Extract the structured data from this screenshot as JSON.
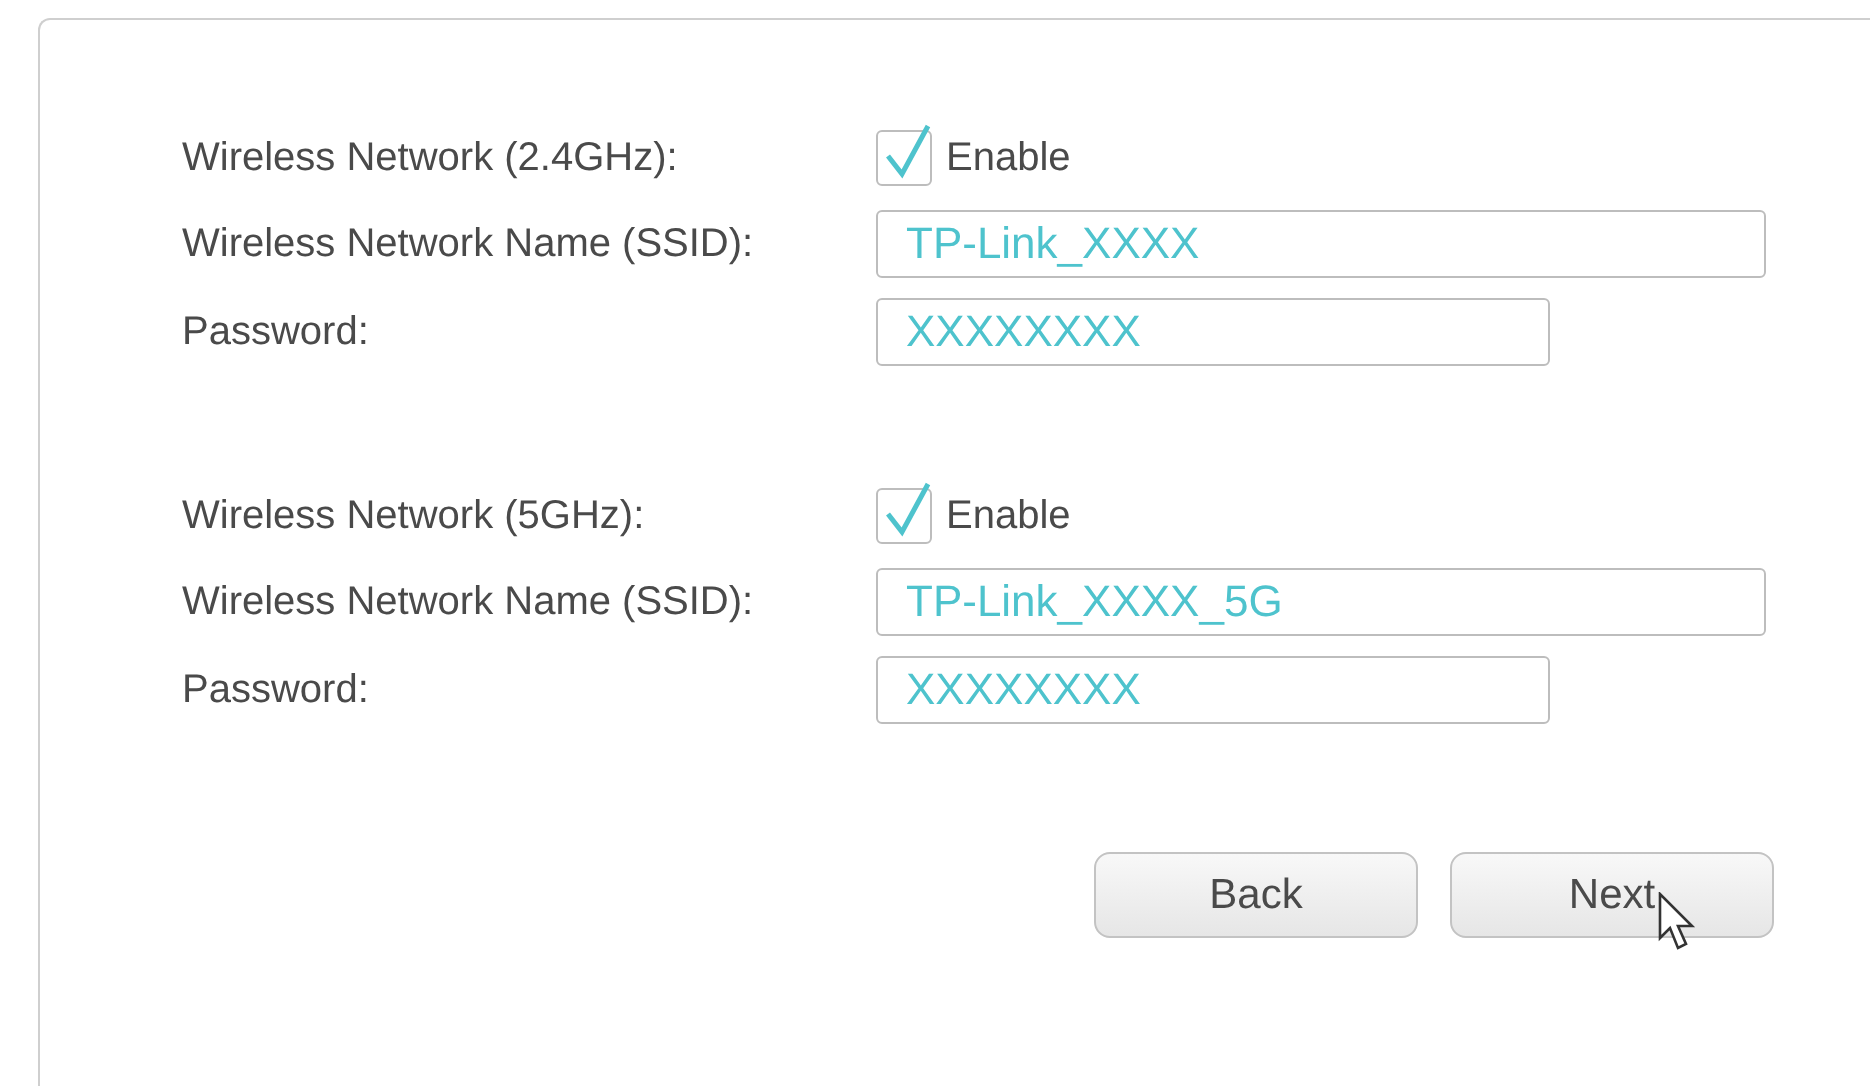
{
  "sections": [
    {
      "label": "Wireless Network (2.4GHz):",
      "enable": {
        "label": "Enable",
        "checked": true
      },
      "ssid": {
        "label": "Wireless Network Name (SSID):",
        "value": "TP-Link_XXXX"
      },
      "password": {
        "label": "Password:",
        "value": "XXXXXXXX"
      }
    },
    {
      "label": "Wireless Network (5GHz):",
      "enable": {
        "label": "Enable",
        "checked": true
      },
      "ssid": {
        "label": "Wireless Network Name (SSID):",
        "value": "TP-Link_XXXX_5G"
      },
      "password": {
        "label": "Password:",
        "value": "XXXXXXXX"
      }
    }
  ],
  "buttons": [
    {
      "label": "Back"
    },
    {
      "label": "Next"
    }
  ]
}
